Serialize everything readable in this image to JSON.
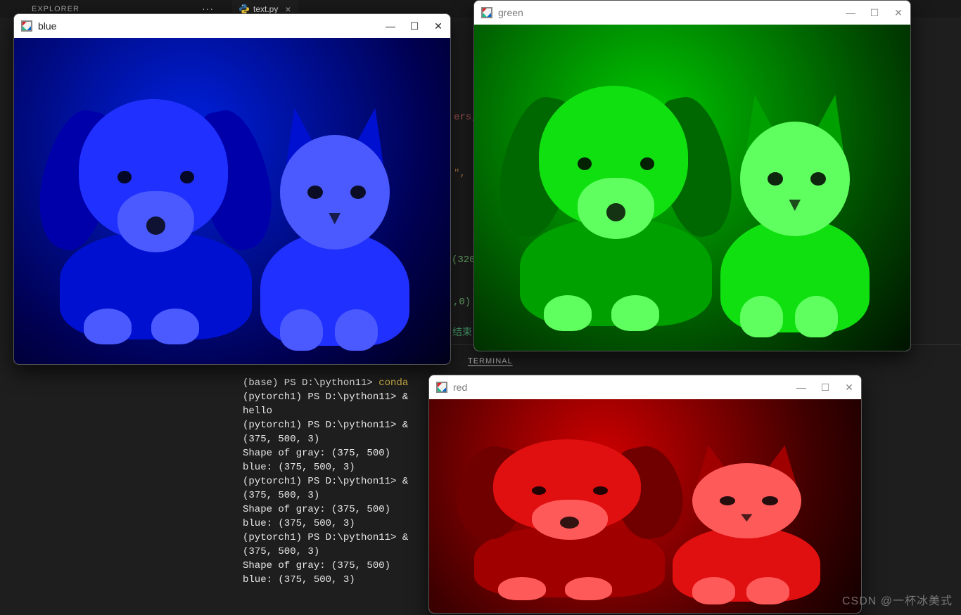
{
  "vscode": {
    "explorer_label": "EXPLORER",
    "overflow_dots": "···",
    "tab": {
      "filename": "text.py",
      "close_glyph": "×"
    }
  },
  "code_fragments": {
    "f1": "ers,",
    "f2": "\",",
    "f3": "(320",
    "f4": ",0)",
    "f5": "结束"
  },
  "terminal": {
    "label": "TERMINAL",
    "lines": [
      {
        "text": "(base) PS D:\\python11> ",
        "cmd": "conda"
      },
      {
        "text": "(pytorch1) PS D:\\python11> &"
      },
      {
        "text": "hello"
      },
      {
        "text": "(pytorch1) PS D:\\python11> &"
      },
      {
        "text": "(375, 500, 3)"
      },
      {
        "text": "Shape of gray: (375, 500)"
      },
      {
        "text": "blue: (375, 500, 3)"
      },
      {
        "text": "(pytorch1) PS D:\\python11> &"
      },
      {
        "text": "(375, 500, 3)"
      },
      {
        "text": "Shape of gray: (375, 500)"
      },
      {
        "text": "blue: (375, 500, 3)"
      },
      {
        "text": "(pytorch1) PS D:\\python11> &"
      },
      {
        "text": "(375, 500, 3)"
      },
      {
        "text": "Shape of gray: (375, 500)"
      },
      {
        "text": "blue: (375, 500, 3)"
      }
    ]
  },
  "windows": {
    "blue": {
      "title": "blue",
      "min": "—",
      "max": "☐",
      "close": "✕",
      "active": true
    },
    "green": {
      "title": "green",
      "min": "—",
      "max": "☐",
      "close": "✕",
      "active": false
    },
    "red": {
      "title": "red",
      "min": "—",
      "max": "☐",
      "close": "✕",
      "active": false
    }
  },
  "watermark": "CSDN @一杯冰美式",
  "image_content": {
    "description": "Photograph of a golden-retriever puppy (left) and an orange tabby kitten (right) lying together on newspaper under a draped blanket.",
    "channels_shown": [
      "blue",
      "green",
      "red"
    ],
    "original_shape": [
      375,
      500,
      3
    ]
  }
}
